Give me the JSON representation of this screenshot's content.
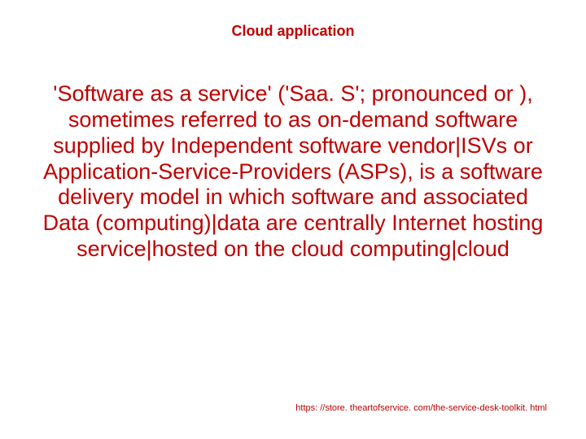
{
  "title": "Cloud application",
  "body": "'Software as a service' ('Saa. S'; pronounced  or ), sometimes referred to as on-demand software supplied by Independent software vendor|ISVs or Application-Service-Providers (ASPs), is a software delivery model in which software and associated Data (computing)|data are centrally Internet hosting service|hosted on the cloud computing|cloud",
  "footer": "https: //store. theartofservice. com/the-service-desk-toolkit. html"
}
